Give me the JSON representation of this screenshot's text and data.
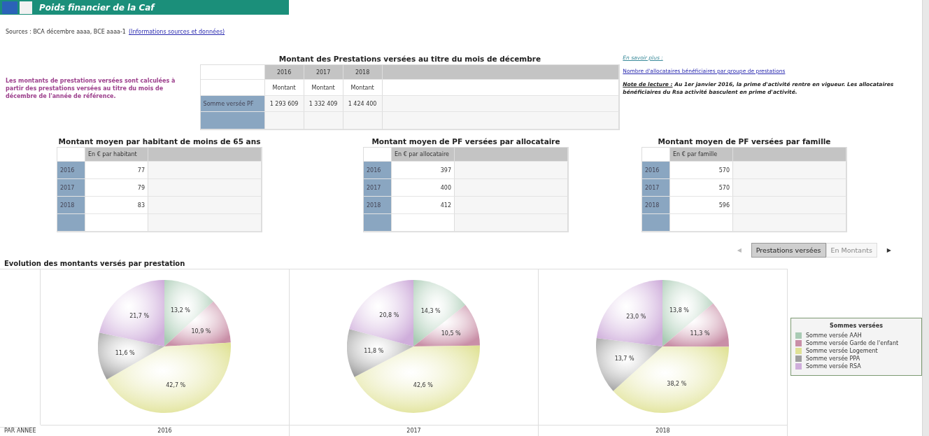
{
  "header": {
    "title": "Poids financier de la Caf"
  },
  "sources": {
    "text": "Sources : BCA décembre aaaa, BCE aaaa-1",
    "link": "(Informations sources et données)"
  },
  "note_left": "Les montants de prestations versées sont calculées à partir des prestations versées au titre du mois de décembre de l'année de référence.",
  "main_table": {
    "title": "Montant des Prestations versées au titre du mois de décembre",
    "years": [
      "2016",
      "2017",
      "2018"
    ],
    "subheaders": [
      "Montant",
      "Montant",
      "Montant"
    ],
    "rows": [
      {
        "label": "Somme versée PF",
        "values": [
          "1 293 609",
          "1 332 409",
          "1 424 400"
        ]
      }
    ]
  },
  "links": {
    "more": "En savoir plus :",
    "link": "Nombre d'allocataires bénéficiaires par groupe de prestations",
    "note_label": "Note de lecture :",
    "note_text": "Au 1er janvier 2016, la prime d'activité rentre en vigueur. Les allocataires bénéficiaires du Rsa activité basculent en prime d'activité."
  },
  "avg_tables": [
    {
      "title": "Montant moyen par habitant de moins de  65 ans",
      "unit": "En € par habitant",
      "rows": [
        {
          "year": "2016",
          "value": "77"
        },
        {
          "year": "2017",
          "value": "79"
        },
        {
          "year": "2018",
          "value": "83"
        }
      ]
    },
    {
      "title": "Montant moyen de PF versées par allocataire",
      "unit": "En € par allocataire",
      "rows": [
        {
          "year": "2016",
          "value": "397"
        },
        {
          "year": "2017",
          "value": "400"
        },
        {
          "year": "2018",
          "value": "412"
        }
      ]
    },
    {
      "title": "Montant moyen de PF versées par famille",
      "unit": "En  € par famille",
      "rows": [
        {
          "year": "2016",
          "value": "570"
        },
        {
          "year": "2017",
          "value": "570"
        },
        {
          "year": "2018",
          "value": "596"
        }
      ]
    }
  ],
  "tabs": [
    {
      "label": "Prestations versées",
      "selected": true
    },
    {
      "label": "En Montants",
      "selected": false
    }
  ],
  "tab_arrows": [
    {
      "glyph": "◀",
      "disabled": true
    },
    {
      "glyph": "▶",
      "disabled": false
    }
  ],
  "section_title": "Evolution des montants versés par prestation",
  "charts_panel": {
    "row_label": "PAR ANNEE",
    "charts": [
      {
        "year": "2016",
        "chart_data": {
          "type": "pie",
          "values": [
            13.2,
            10.9,
            42.7,
            11.6,
            21.7
          ],
          "value_labels": [
            "13,2 %",
            "10,9 %",
            "42,7 %",
            "11,6 %",
            "21,7 %"
          ]
        }
      },
      {
        "year": "2017",
        "chart_data": {
          "type": "pie",
          "values": [
            14.3,
            10.5,
            42.6,
            11.8,
            20.8
          ],
          "value_labels": [
            "14,3 %",
            "10,5 %",
            "42,6 %",
            "11,8 %",
            "20,8 %"
          ]
        }
      },
      {
        "year": "2018",
        "chart_data": {
          "type": "pie",
          "values": [
            13.8,
            11.3,
            38.2,
            13.7,
            23.0
          ],
          "value_labels": [
            "13,8 %",
            "11,3 %",
            "38,2 %",
            "13,7 %",
            "23,0 %"
          ]
        }
      }
    ]
  },
  "legend": {
    "title": "Sommes versées",
    "items": [
      {
        "label": "Somme versée AAH",
        "color": "#a9cbb4"
      },
      {
        "label": "Somme versée Garde de l'enfant",
        "color": "#c98fa7"
      },
      {
        "label": "Somme versée Logement",
        "color": "#e0e296"
      },
      {
        "label": "Somme versée PPA",
        "color": "#9e9e9e"
      },
      {
        "label": "Somme versée RSA",
        "color": "#cfaedb"
      }
    ]
  }
}
